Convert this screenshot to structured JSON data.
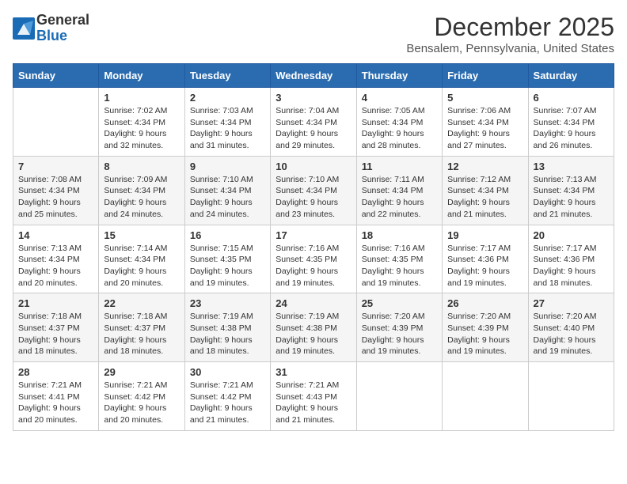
{
  "logo": {
    "general": "General",
    "blue": "Blue"
  },
  "title": "December 2025",
  "location": "Bensalem, Pennsylvania, United States",
  "days_header": [
    "Sunday",
    "Monday",
    "Tuesday",
    "Wednesday",
    "Thursday",
    "Friday",
    "Saturday"
  ],
  "weeks": [
    [
      {
        "num": "",
        "info": ""
      },
      {
        "num": "1",
        "info": "Sunrise: 7:02 AM\nSunset: 4:34 PM\nDaylight: 9 hours\nand 32 minutes."
      },
      {
        "num": "2",
        "info": "Sunrise: 7:03 AM\nSunset: 4:34 PM\nDaylight: 9 hours\nand 31 minutes."
      },
      {
        "num": "3",
        "info": "Sunrise: 7:04 AM\nSunset: 4:34 PM\nDaylight: 9 hours\nand 29 minutes."
      },
      {
        "num": "4",
        "info": "Sunrise: 7:05 AM\nSunset: 4:34 PM\nDaylight: 9 hours\nand 28 minutes."
      },
      {
        "num": "5",
        "info": "Sunrise: 7:06 AM\nSunset: 4:34 PM\nDaylight: 9 hours\nand 27 minutes."
      },
      {
        "num": "6",
        "info": "Sunrise: 7:07 AM\nSunset: 4:34 PM\nDaylight: 9 hours\nand 26 minutes."
      }
    ],
    [
      {
        "num": "7",
        "info": "Sunrise: 7:08 AM\nSunset: 4:34 PM\nDaylight: 9 hours\nand 25 minutes."
      },
      {
        "num": "8",
        "info": "Sunrise: 7:09 AM\nSunset: 4:34 PM\nDaylight: 9 hours\nand 24 minutes."
      },
      {
        "num": "9",
        "info": "Sunrise: 7:10 AM\nSunset: 4:34 PM\nDaylight: 9 hours\nand 24 minutes."
      },
      {
        "num": "10",
        "info": "Sunrise: 7:10 AM\nSunset: 4:34 PM\nDaylight: 9 hours\nand 23 minutes."
      },
      {
        "num": "11",
        "info": "Sunrise: 7:11 AM\nSunset: 4:34 PM\nDaylight: 9 hours\nand 22 minutes."
      },
      {
        "num": "12",
        "info": "Sunrise: 7:12 AM\nSunset: 4:34 PM\nDaylight: 9 hours\nand 21 minutes."
      },
      {
        "num": "13",
        "info": "Sunrise: 7:13 AM\nSunset: 4:34 PM\nDaylight: 9 hours\nand 21 minutes."
      }
    ],
    [
      {
        "num": "14",
        "info": "Sunrise: 7:13 AM\nSunset: 4:34 PM\nDaylight: 9 hours\nand 20 minutes."
      },
      {
        "num": "15",
        "info": "Sunrise: 7:14 AM\nSunset: 4:34 PM\nDaylight: 9 hours\nand 20 minutes."
      },
      {
        "num": "16",
        "info": "Sunrise: 7:15 AM\nSunset: 4:35 PM\nDaylight: 9 hours\nand 19 minutes."
      },
      {
        "num": "17",
        "info": "Sunrise: 7:16 AM\nSunset: 4:35 PM\nDaylight: 9 hours\nand 19 minutes."
      },
      {
        "num": "18",
        "info": "Sunrise: 7:16 AM\nSunset: 4:35 PM\nDaylight: 9 hours\nand 19 minutes."
      },
      {
        "num": "19",
        "info": "Sunrise: 7:17 AM\nSunset: 4:36 PM\nDaylight: 9 hours\nand 19 minutes."
      },
      {
        "num": "20",
        "info": "Sunrise: 7:17 AM\nSunset: 4:36 PM\nDaylight: 9 hours\nand 18 minutes."
      }
    ],
    [
      {
        "num": "21",
        "info": "Sunrise: 7:18 AM\nSunset: 4:37 PM\nDaylight: 9 hours\nand 18 minutes."
      },
      {
        "num": "22",
        "info": "Sunrise: 7:18 AM\nSunset: 4:37 PM\nDaylight: 9 hours\nand 18 minutes."
      },
      {
        "num": "23",
        "info": "Sunrise: 7:19 AM\nSunset: 4:38 PM\nDaylight: 9 hours\nand 18 minutes."
      },
      {
        "num": "24",
        "info": "Sunrise: 7:19 AM\nSunset: 4:38 PM\nDaylight: 9 hours\nand 19 minutes."
      },
      {
        "num": "25",
        "info": "Sunrise: 7:20 AM\nSunset: 4:39 PM\nDaylight: 9 hours\nand 19 minutes."
      },
      {
        "num": "26",
        "info": "Sunrise: 7:20 AM\nSunset: 4:39 PM\nDaylight: 9 hours\nand 19 minutes."
      },
      {
        "num": "27",
        "info": "Sunrise: 7:20 AM\nSunset: 4:40 PM\nDaylight: 9 hours\nand 19 minutes."
      }
    ],
    [
      {
        "num": "28",
        "info": "Sunrise: 7:21 AM\nSunset: 4:41 PM\nDaylight: 9 hours\nand 20 minutes."
      },
      {
        "num": "29",
        "info": "Sunrise: 7:21 AM\nSunset: 4:42 PM\nDaylight: 9 hours\nand 20 minutes."
      },
      {
        "num": "30",
        "info": "Sunrise: 7:21 AM\nSunset: 4:42 PM\nDaylight: 9 hours\nand 21 minutes."
      },
      {
        "num": "31",
        "info": "Sunrise: 7:21 AM\nSunset: 4:43 PM\nDaylight: 9 hours\nand 21 minutes."
      },
      {
        "num": "",
        "info": ""
      },
      {
        "num": "",
        "info": ""
      },
      {
        "num": "",
        "info": ""
      }
    ]
  ]
}
